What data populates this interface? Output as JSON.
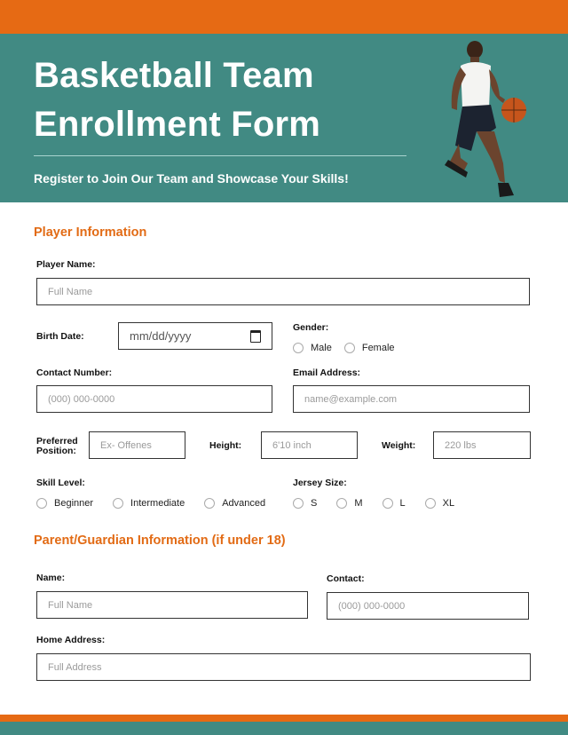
{
  "header": {
    "title_line1": "Basketball Team",
    "title_line2": "Enrollment Form",
    "subtitle": "Register to Join Our Team and Showcase Your Skills!",
    "image_alt": "basketball-player-dribbling"
  },
  "colors": {
    "orange": "#e66a14",
    "teal": "#418a83"
  },
  "player_section": {
    "title": "Player Information",
    "player_name": {
      "label": "Player Name:",
      "placeholder": "Full Name"
    },
    "birth_date": {
      "label": "Birth Date:",
      "placeholder": "mm/dd/yyyy"
    },
    "gender": {
      "label": "Gender:",
      "options": [
        "Male",
        "Female"
      ]
    },
    "contact": {
      "label": "Contact Number:",
      "placeholder": "(000) 000-0000"
    },
    "email": {
      "label": "Email Address:",
      "placeholder": "name@example.com"
    },
    "position": {
      "label_line1": "Preferred",
      "label_line2": "Position:",
      "placeholder": "Ex- Offenes"
    },
    "height": {
      "label": "Height:",
      "placeholder": "6'10 inch"
    },
    "weight": {
      "label": "Weight:",
      "placeholder": "220 lbs"
    },
    "skill": {
      "label": "Skill Level:",
      "options": [
        "Beginner",
        "Intermediate",
        "Advanced"
      ]
    },
    "jersey": {
      "label": "Jersey Size:",
      "options": [
        "S",
        "M",
        "L",
        "XL"
      ]
    }
  },
  "guardian_section": {
    "title": "Parent/Guardian Information (if under 18)",
    "name": {
      "label": "Name:",
      "placeholder": "Full Name"
    },
    "contact": {
      "label": "Contact:",
      "placeholder": "(000) 000-0000"
    },
    "address": {
      "label": "Home Address:",
      "placeholder": "Full Address"
    }
  }
}
